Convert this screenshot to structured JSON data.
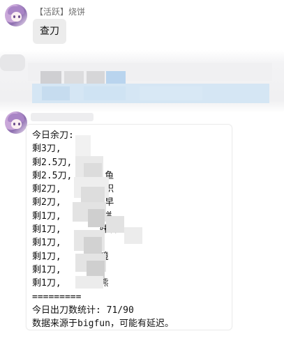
{
  "message1": {
    "sender": "【活跃】烧饼",
    "text": "查刀"
  },
  "message2": {
    "lines": [
      "今日余刀:",
      "剩3刀,",
      "剩2.5刀,",
      "剩2.5刀,      鱼",
      "剩2刀,        织",
      "剩2刀,        早",
      "剩1刀,      烧饼",
      "剩1刀,       妹者",
      "剩1刀,",
      "剩1刀,       镜",
      "剩1刀,",
      "剩1刀,       熊",
      "=========",
      "今日出刀数统计: 71/90",
      "数据来源于bigfun，可能有延迟。"
    ]
  },
  "colors": {
    "bubble_gray": "#ececec",
    "sender_gray": "#6f6f6f",
    "blur_blue": "#cfe3f3"
  }
}
